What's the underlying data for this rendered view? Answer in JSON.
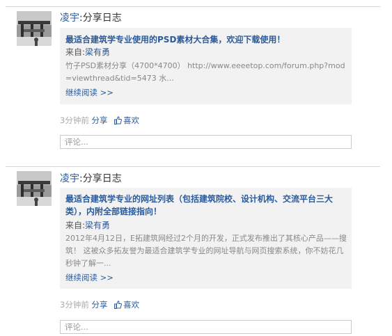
{
  "posts": [
    {
      "author": "凌宇",
      "action": ":分享日志",
      "share": {
        "title": "最适合建筑学专业使用的PSD素材大合集，欢迎下载使用！",
        "from_label": "来自:",
        "from_name": "梁有勇",
        "excerpt": "竹子PSD素材分享（4700*4700）  http://www.eeeetop.com/forum.php?mod=viewthread&tid=5473 水...",
        "read_more": "继续阅读 >>"
      },
      "time": "3分钟前",
      "share_label": "分享",
      "like_label": "喜欢",
      "comment_placeholder": "评论..."
    },
    {
      "author": "凌宇",
      "action": ":分享日志",
      "share": {
        "title": "最适合建筑学专业的网址列表（包括建筑院校、设计机构、交流平台三大类），内附全部链接指向！",
        "from_label": "来自:",
        "from_name": "梁有勇",
        "excerpt": "2012年4月12日，E拓建筑网经过2个月的开发，正式发布推出了其核心产品——搜筑！ 这被众多拓友誉为最适合建筑学专业的网址导航与网页搜索系统，你不妨花几秒钟了解一...",
        "read_more": "继续阅读 >>"
      },
      "time": "3分钟前",
      "share_label": "分享",
      "like_label": "喜欢",
      "comment_placeholder": "评论..."
    }
  ],
  "icons": {
    "like": "thumbs-up-icon"
  },
  "colors": {
    "link": "#2b5b9a",
    "card_bg": "#f2f2f2",
    "muted": "#aaaaaa"
  }
}
